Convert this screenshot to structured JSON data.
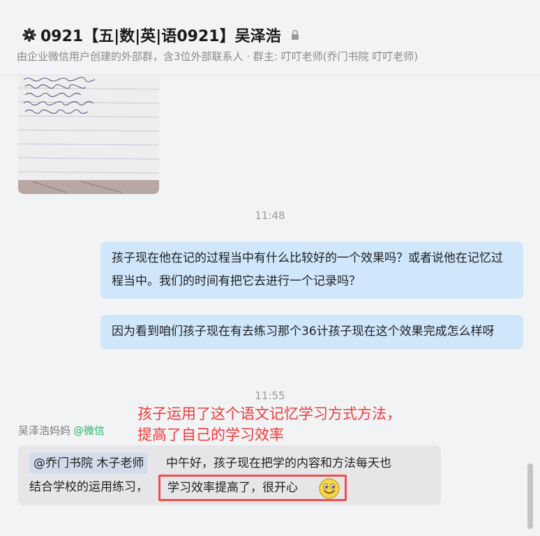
{
  "header": {
    "title": "0921【五|数|英|语0921】吴泽浩",
    "subtitle": "由企业微信用户创建的外部群，含3位外部联系人 · 群主: 叮叮老师(乔门书院 叮叮老师)"
  },
  "messages": {
    "time1": "11:48",
    "out1": "孩子现在他在记的过程当中有什么比较好的一个效果吗？或者说他在记忆过程当中。我们的时间有把它去进行一个记录吗？",
    "out2": "因为看到咱们孩子现在有去练习那个36计孩子现在这个效果完成怎么样呀",
    "time2": "11:55",
    "sender_name": "吴泽浩妈妈",
    "sender_source": "@微信",
    "mention": "@乔门书院 木子老师",
    "line1_rest": "中午好，孩子现在把学的内容和方法每天也",
    "line2_start": "结合学校的运用练习，",
    "highlight": "学习效率提高了，很开心"
  },
  "annotation": {
    "line1": "孩子运用了这个语文记忆学习方式方法，",
    "line2": "提高了自己的学习效率"
  },
  "colors": {
    "outgoing_bubble": "#cfe6fb",
    "incoming_bubble": "#e6e6e8",
    "annotation": "#ef3b3b",
    "wechat_green": "#2fb36a"
  }
}
